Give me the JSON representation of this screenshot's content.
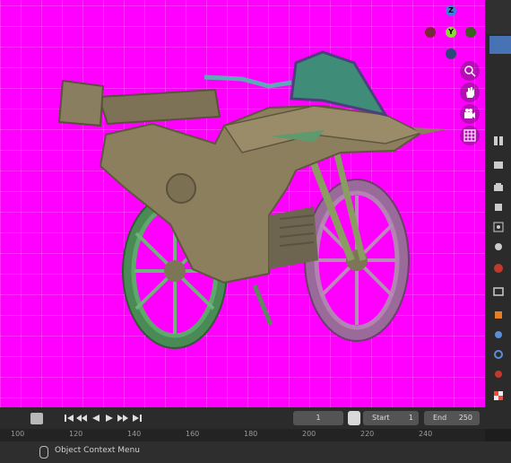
{
  "viewport": {
    "gizmo": {
      "z": "Z",
      "y": "Y",
      "x_color": "#c8334a",
      "y_color": "#6fb52c",
      "z_color": "#3d7fd6"
    }
  },
  "timeline": {
    "current_frame": "1",
    "start_label": "Start",
    "start_value": "1",
    "end_label": "End",
    "end_value": "250",
    "ruler_ticks": [
      "100",
      "120",
      "140",
      "160",
      "180",
      "200",
      "220",
      "240"
    ]
  },
  "status": {
    "context_menu": "Object Context Menu"
  },
  "colors": {
    "viewport_bg": "#ff00ff",
    "accent": "#4772b3"
  }
}
